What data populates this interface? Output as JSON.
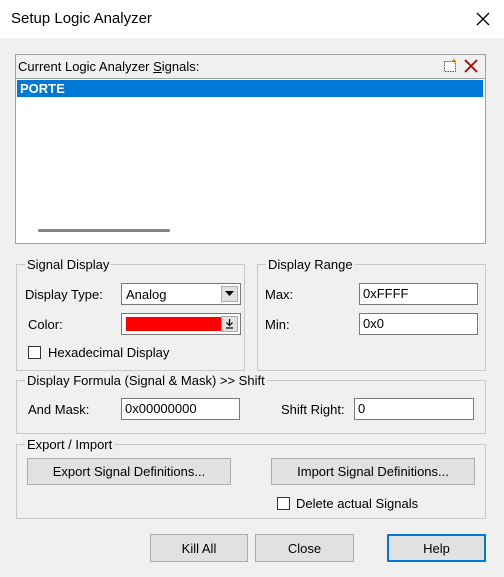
{
  "window": {
    "title": "Setup Logic Analyzer"
  },
  "signals": {
    "label": "Current Logic Analyzer Signals:",
    "items": [
      "PORTE"
    ],
    "selected_index": 0
  },
  "signal_display": {
    "group_label": "Signal Display",
    "display_type_label": "Display Type:",
    "display_type_value": "Analog",
    "color_label": "Color:",
    "color_value": "#ff0000",
    "hex_display_label": "Hexadecimal Display",
    "hex_display_checked": false
  },
  "display_range": {
    "group_label": "Display Range",
    "max_label": "Max:",
    "max_value": "0xFFFF",
    "min_label": "Min:",
    "min_value": "0x0"
  },
  "formula": {
    "group_label": "Display Formula (Signal & Mask) >> Shift",
    "and_mask_label": "And Mask:",
    "and_mask_value": "0x00000000",
    "shift_right_label": "Shift Right:",
    "shift_right_value": "0"
  },
  "export_import": {
    "group_label": "Export / Import",
    "export_button": "Export Signal Definitions...",
    "import_button": "Import Signal Definitions...",
    "delete_label": "Delete actual Signals",
    "delete_checked": false
  },
  "buttons": {
    "kill_all": "Kill All",
    "close": "Close",
    "help": "Help"
  },
  "colors": {
    "accent": "#0078d7",
    "signal_color": "#ff0000"
  }
}
